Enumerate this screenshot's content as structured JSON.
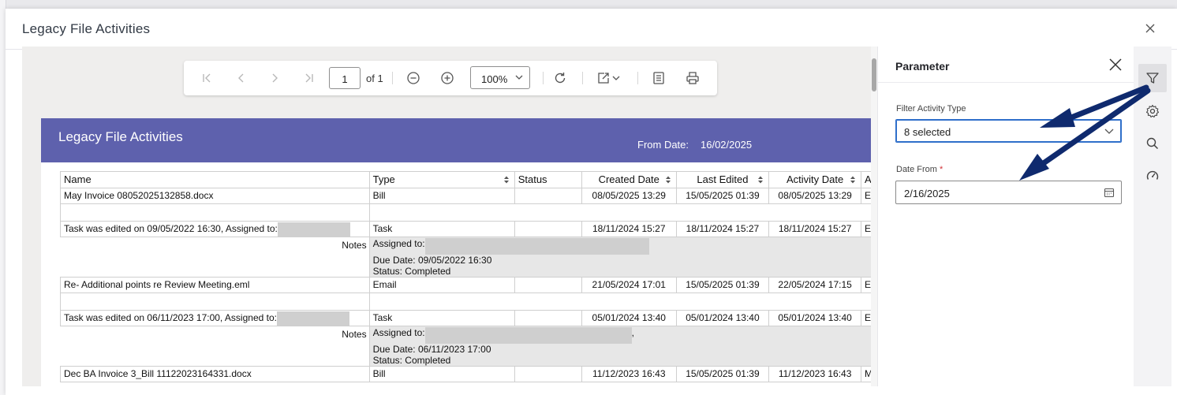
{
  "dialog": {
    "title": "Legacy File Activities"
  },
  "toolbar": {
    "page_current": "1",
    "page_of": "of 1",
    "zoom": "100%",
    "icons": [
      "first-page-icon",
      "prev-page-icon",
      "next-page-icon",
      "last-page-icon",
      "zoom-out-icon",
      "zoom-in-icon",
      "refresh-icon",
      "export-icon",
      "document-map-icon",
      "print-icon"
    ]
  },
  "report": {
    "title": "Legacy File Activities",
    "from_date_label": "From Date:",
    "from_date_value": "16/02/2025",
    "band_color": "#5e61ad",
    "columns": [
      "Name",
      "Type",
      "Status",
      "Created Date",
      "Last Edited",
      "Activity Date",
      "A"
    ],
    "rows": [
      {
        "name": "May Invoice 08052025132858.docx",
        "type": "Bill",
        "status": "",
        "created": "08/05/2025 13:29",
        "edited": "15/05/2025 01:39",
        "activity": "08/05/2025 13:29",
        "extra": "E"
      },
      {
        "name": "Task was edited on 09/05/2022 16:30, Assigned to:",
        "type": "Task",
        "status": "",
        "created": "18/11/2024 15:27",
        "edited": "18/11/2024 15:27",
        "activity": "18/11/2024 15:27",
        "extra": "E"
      },
      {
        "name": "Re- Additional points re Review Meeting.eml",
        "type": "Email",
        "status": "",
        "created": "21/05/2024 17:01",
        "edited": "15/05/2025 01:39",
        "activity": "22/05/2024 17:15",
        "extra": "E"
      },
      {
        "name": "Task was edited on 06/11/2023 17:00, Assigned to:",
        "type": "Task",
        "status": "",
        "created": "05/01/2024 13:40",
        "edited": "05/01/2024 13:40",
        "activity": "05/01/2024 13:40",
        "extra": "E"
      },
      {
        "name": "Dec BA Invoice 3_Bill 11122023164331.docx",
        "type": "Bill",
        "status": "",
        "created": "11/12/2023 16:43",
        "edited": "15/05/2025 01:39",
        "activity": "11/12/2023 16:43",
        "extra": "M"
      }
    ],
    "notes_label": "Notes",
    "notes": [
      {
        "assigned": "Assigned to:",
        "due": "Due Date: 09/05/2022 16:30",
        "status": "Status: Completed"
      },
      {
        "assigned": "Assigned to:",
        "assigned_suffix": ",",
        "due": "Due Date: 06/11/2023 17:00",
        "status": "Status: Completed"
      }
    ]
  },
  "parameter_panel": {
    "title": "Parameter",
    "filter_label": "Filter Activity Type",
    "filter_value": "8 selected",
    "date_label": "Date From",
    "required_mark": "*",
    "date_value": "2/16/2025"
  },
  "side_strip": {
    "icons": [
      "filter-icon",
      "settings-icon",
      "search-icon",
      "gauge-icon"
    ]
  },
  "colors": {
    "annotation_arrow": "#0f2a6e",
    "accent_blue": "#2f6fca"
  }
}
